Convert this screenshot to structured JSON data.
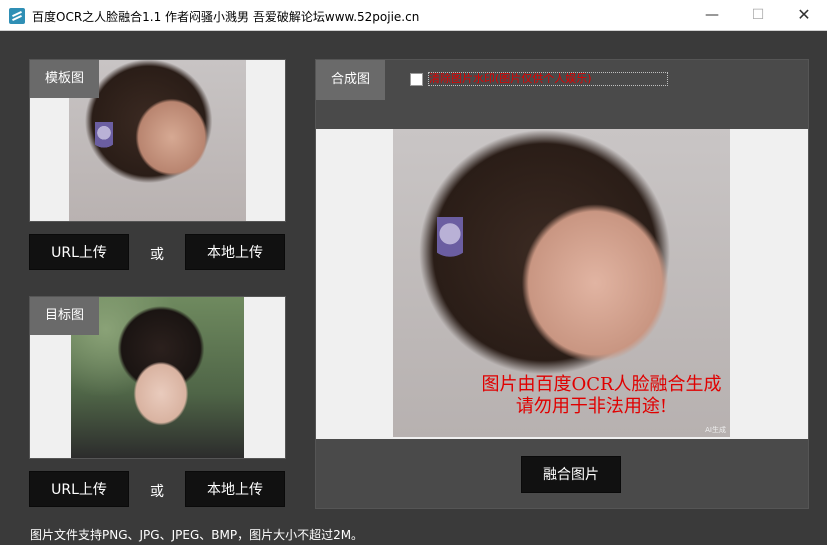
{
  "window": {
    "title": "百度OCR之人脸融合1.1 作者闷骚小溅男 吾爱破解论坛www.52pojie.cn",
    "min_glyph": "—",
    "max_glyph": "☐",
    "close_glyph": "✕"
  },
  "template_panel": {
    "label": "模板图",
    "url_upload": "URL上传",
    "or": "或",
    "local_upload": "本地上传"
  },
  "target_panel": {
    "label": "目标图",
    "url_upload": "URL上传",
    "or": "或",
    "local_upload": "本地上传"
  },
  "result_panel": {
    "label": "合成图",
    "checkbox_label": "清除图片水印(图片仅供个人娱乐)",
    "watermark_line1": "图片由百度OCR人脸融合生成",
    "watermark_line2": "请勿用于非法用途!",
    "image_tag": "AI生成",
    "merge_button": "融合图片"
  },
  "footer": {
    "note": "图片文件支持PNG、JPG、JPEG、BMP，图片大小不超过2M。"
  },
  "colors": {
    "background": "#3a3a3a",
    "panel": "#f0f0f0",
    "label_bg": "#6a6a6a",
    "button_bg": "#111111",
    "watermark": "#e00000"
  }
}
